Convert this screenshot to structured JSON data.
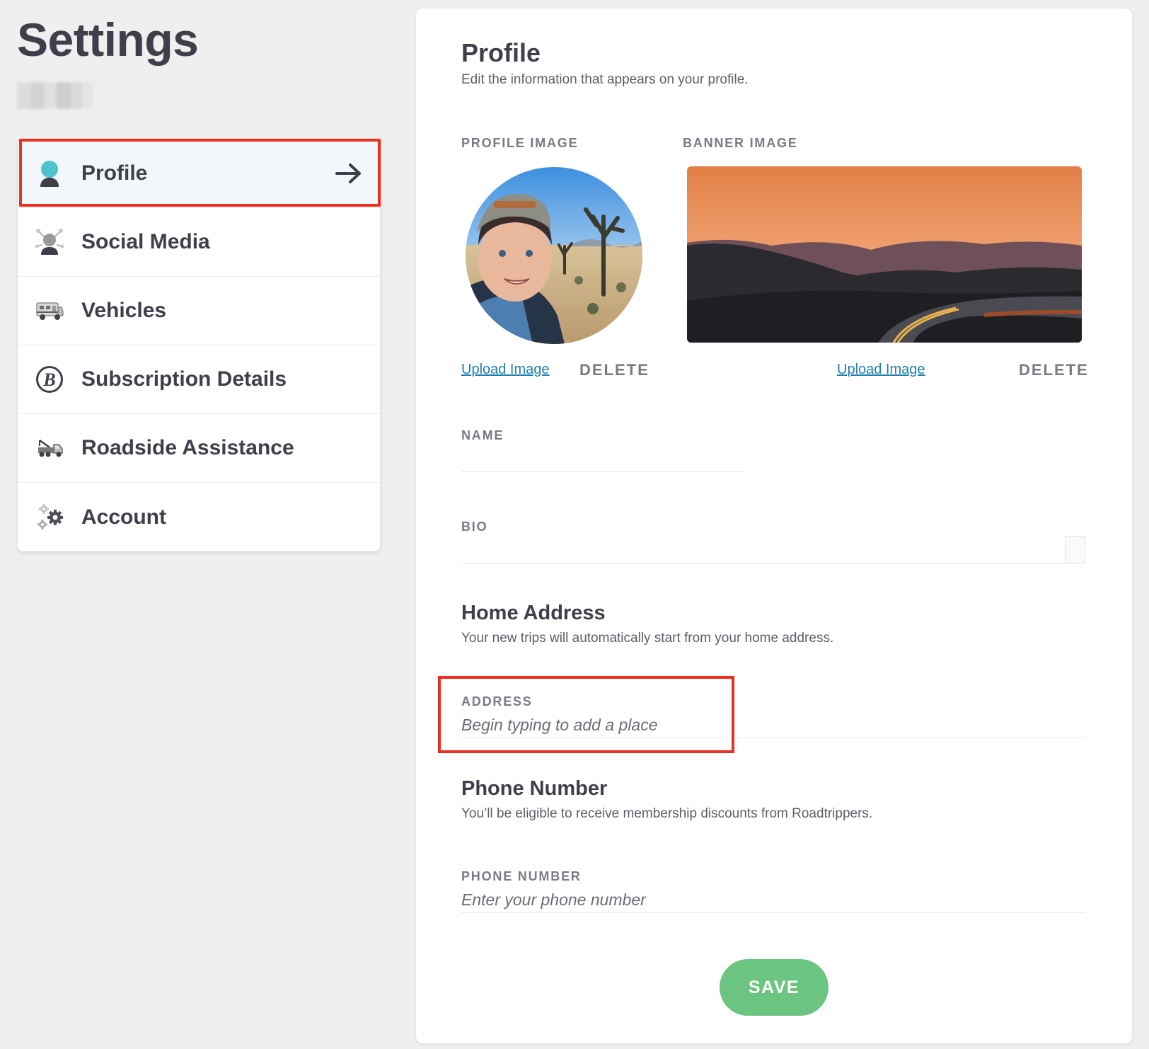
{
  "page": {
    "title": "Settings"
  },
  "sidebar": {
    "items": [
      {
        "label": "Profile",
        "icon": "profile-icon",
        "active": true
      },
      {
        "label": "Social Media",
        "icon": "social-media-icon"
      },
      {
        "label": "Vehicles",
        "icon": "rv-vehicle-icon"
      },
      {
        "label": "Subscription Details",
        "icon": "roadtrippers-b-icon"
      },
      {
        "label": "Roadside Assistance",
        "icon": "tow-truck-icon"
      },
      {
        "label": "Account",
        "icon": "gears-icon"
      }
    ]
  },
  "profile": {
    "title": "Profile",
    "subtitle": "Edit the information that appears on your profile.",
    "profile_image_label": "PROFILE IMAGE",
    "banner_image_label": "BANNER IMAGE",
    "upload_label": "Upload Image",
    "delete_label": "DELETE",
    "name_label": "NAME",
    "bio_label": "BIO"
  },
  "home_address": {
    "title": "Home Address",
    "subtitle": "Your new trips will automatically start from your home address.",
    "address_label": "ADDRESS",
    "address_placeholder": "Begin typing to add a place"
  },
  "phone": {
    "title": "Phone Number",
    "subtitle": "You’ll be eligible to receive membership discounts from Roadtrippers.",
    "phone_label": "PHONE NUMBER",
    "phone_placeholder": "Enter your phone number"
  },
  "actions": {
    "save_label": "SAVE"
  },
  "colors": {
    "accent_link": "#1f7fb3",
    "save_button": "#6bc480",
    "highlight": "#ee2f1f",
    "active_item_bg": "#f1f7fb",
    "profile_icon": "#4cc3cf"
  }
}
